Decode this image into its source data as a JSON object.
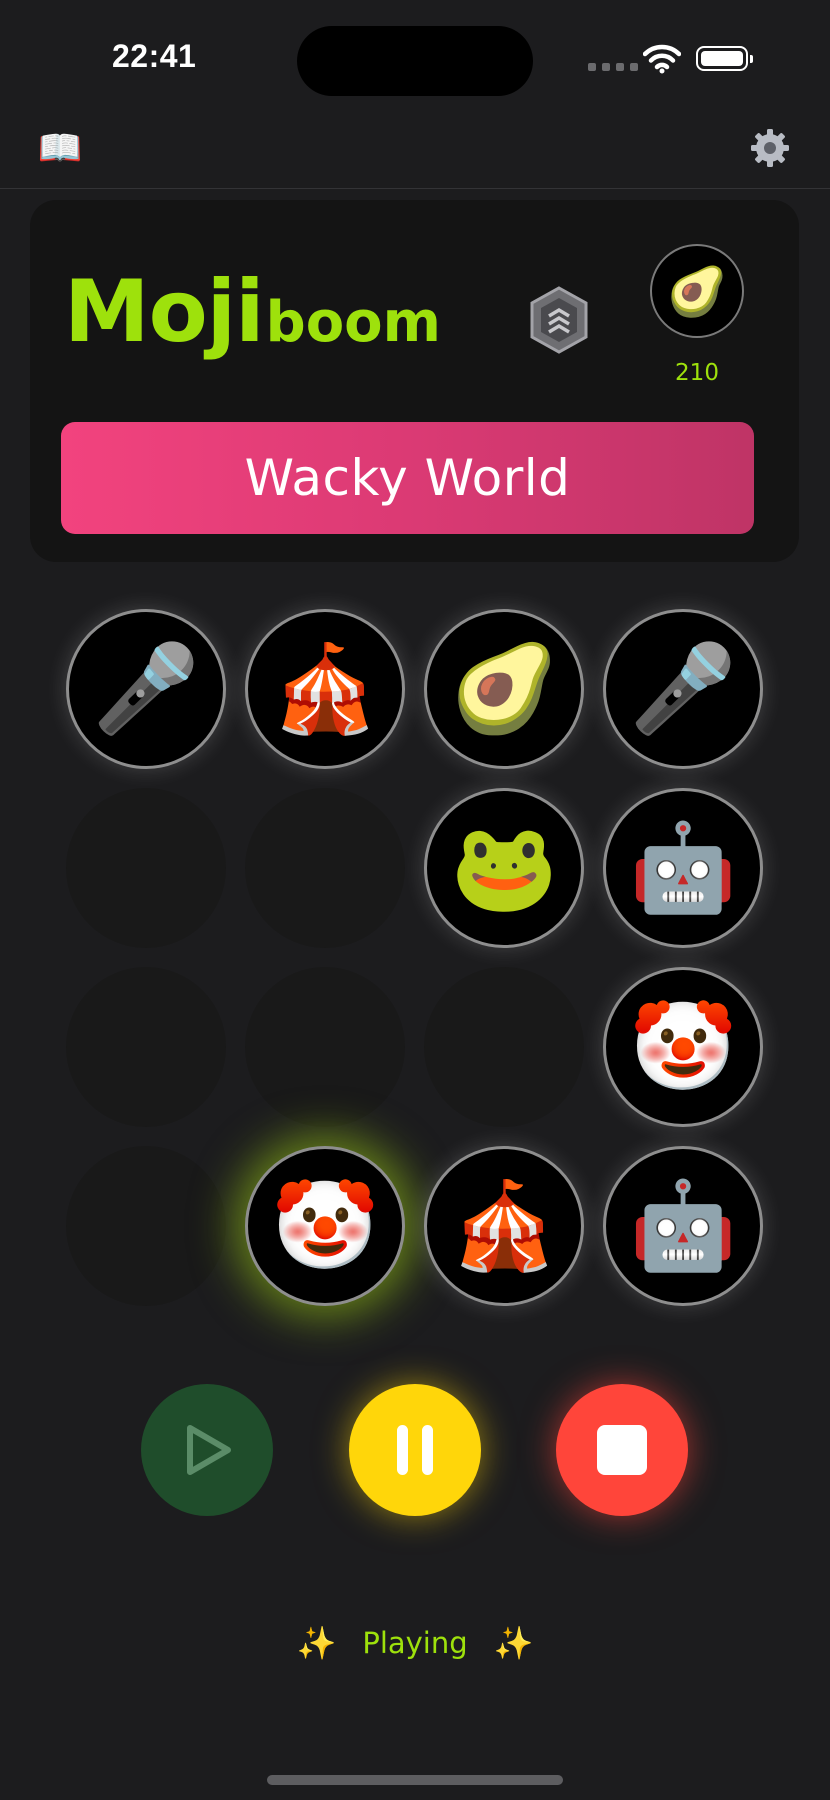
{
  "status_bar": {
    "time": "22:41"
  },
  "toolbar": {
    "book_icon": "📖",
    "settings_icon": "gear-icon"
  },
  "header": {
    "logo_main": "Moji",
    "logo_sub": "boom",
    "coin_icon": "🥑",
    "coin_count": "210",
    "world_name": "Wacky World"
  },
  "grid": {
    "rows": [
      [
        {
          "emoji": "🎤",
          "state": "filled"
        },
        {
          "emoji": "🎪",
          "state": "filled"
        },
        {
          "emoji": "🥑",
          "state": "filled"
        },
        {
          "emoji": "🎤",
          "state": "filled"
        }
      ],
      [
        {
          "emoji": "",
          "state": "empty"
        },
        {
          "emoji": "",
          "state": "empty"
        },
        {
          "emoji": "🐸",
          "state": "filled"
        },
        {
          "emoji": "🤖",
          "state": "filled"
        }
      ],
      [
        {
          "emoji": "",
          "state": "empty"
        },
        {
          "emoji": "",
          "state": "empty"
        },
        {
          "emoji": "",
          "state": "empty"
        },
        {
          "emoji": "🤡",
          "state": "filled"
        }
      ],
      [
        {
          "emoji": "",
          "state": "empty"
        },
        {
          "emoji": "🤡",
          "state": "active"
        },
        {
          "emoji": "🎪",
          "state": "filled"
        },
        {
          "emoji": "🤖",
          "state": "filled"
        }
      ]
    ]
  },
  "controls": {
    "play": "play-icon",
    "pause": "pause-icon",
    "stop": "stop-icon"
  },
  "status": {
    "sparkle": "✨",
    "text": "Playing"
  },
  "colors": {
    "accent": "#9ee10c",
    "banner": "#e63e78",
    "pause": "#ffd60a",
    "stop": "#ff453a",
    "play": "#1f4d2b"
  }
}
